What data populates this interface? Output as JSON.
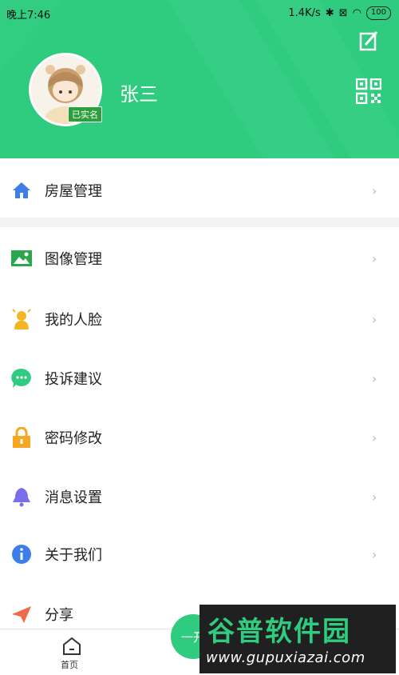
{
  "status_bar": {
    "time": "晚上7:46",
    "speed": "1.4K/s",
    "battery": "100"
  },
  "profile": {
    "name": "张三",
    "verified_badge": "已实名"
  },
  "menu": {
    "items": [
      {
        "label": "房屋管理",
        "icon": "home-icon",
        "color": "#3d7eea"
      },
      {
        "label": "图像管理",
        "icon": "image-icon",
        "color": "#2aa74d"
      },
      {
        "label": "我的人脸",
        "icon": "face-icon",
        "color": "#f5b625"
      },
      {
        "label": "投诉建议",
        "icon": "chat-icon",
        "color": "#2fcb7e"
      },
      {
        "label": "密码修改",
        "icon": "lock-icon",
        "color": "#f5a623"
      },
      {
        "label": "消息设置",
        "icon": "bell-icon",
        "color": "#7a6fe8"
      },
      {
        "label": "关于我们",
        "icon": "info-icon",
        "color": "#3d7eea"
      },
      {
        "label": "分享",
        "icon": "share-icon",
        "color": "#f06a4a"
      }
    ],
    "chevron": "›"
  },
  "bottom_nav": {
    "home_label": "首页",
    "fab_label": "一开"
  },
  "watermark": {
    "title": "谷普软件园",
    "url": "www.gupuxiazai.com"
  },
  "colors": {
    "brand_green": "#2fcb7e"
  }
}
